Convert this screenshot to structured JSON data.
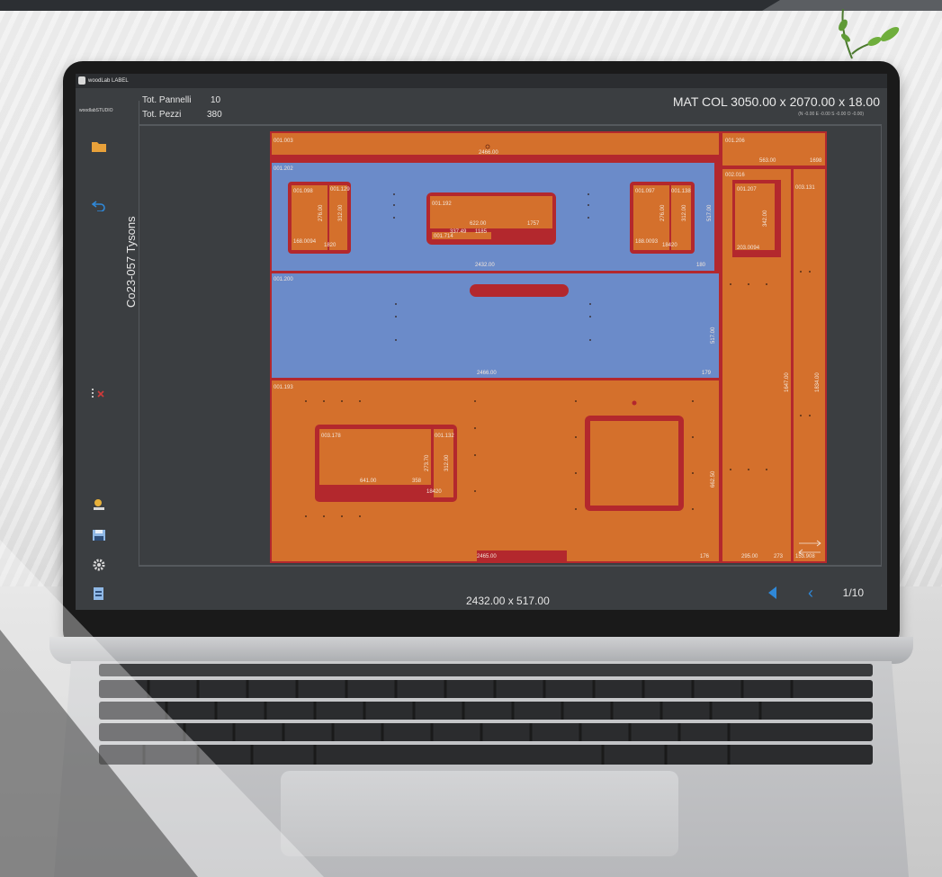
{
  "app": {
    "window_title": "woodLab LABEL",
    "brand": "woodlabSTUDIO",
    "project": "Co23-057 Tysons"
  },
  "stats": {
    "panels_label": "Tot. Pannelli",
    "panels_value": "10",
    "pieces_label": "Tot. Pezzi",
    "pieces_value": "380"
  },
  "material": {
    "title": "MAT COL 3050.00 x 2070.00 x 18.00",
    "offsets": "(N -0.00  E -0.00  S -0.00  O -0.00)"
  },
  "footer": {
    "selected_size": "2432.00 x 517.00",
    "page": "1/10"
  },
  "sidebar": {
    "icons": [
      "folder-icon",
      "undo-icon",
      "delete-icon",
      "user-settings-icon",
      "save-icon",
      "settings-gear-icon",
      "export-file-icon"
    ]
  },
  "colors": {
    "panel_orange": "#d4702c",
    "panel_blue": "#6b8bc9",
    "edge_red": "#b3282d",
    "nav_blue": "#2f88d8",
    "folder_amber": "#e8a13a"
  },
  "labels": {
    "p1": "001.003",
    "p1_dim": "2466.00",
    "p2": "001.206",
    "p2_dim": "563.00",
    "p2_h": "1698",
    "p3": "001.202",
    "p3_dim": "2432.00",
    "p3_h": "517.00",
    "p3_e": "180",
    "p3a": "001.098",
    "p3b": "001.129",
    "p3a_w": "168.0094",
    "p3a_b": "1820",
    "p3a_h": "276.00",
    "p3a_h2": "312.00",
    "p3c": "001.192",
    "p3c_w": "622.00",
    "p3c_b": "001.714",
    "p3c_b2": "337.49",
    "p3c_b3": "1185",
    "p3c_h": "1757",
    "p3d": "001.097",
    "p3e": "001.138",
    "p3d_w": "188.0093",
    "p3d_b": "18420",
    "p3d_h": "276.00",
    "p3d_h2": "312.00",
    "p4": "001.200",
    "p4_dim": "2466.00",
    "p4_h": "517.00",
    "p4_e": "179",
    "p5": "001.193",
    "p5_dim": "2465.00",
    "p5_e": "176",
    "p5a": "003.178",
    "p5b": "001.132",
    "p5a_w": "641.00",
    "p5a_s": "358",
    "p5a_b": "18420",
    "p5a_h": "273.70",
    "p5a_h2": "312.00",
    "p5_h": "662.50",
    "p6": "002.016",
    "p6a": "001.207",
    "p6a_w": "203.0094",
    "p6a_h": "342.00",
    "p6_h": "1647.00",
    "p6_b1": "295.00",
    "p6_b2": "273",
    "p7": "003.131",
    "p7_h": "1834.00",
    "p7_b": "153.908"
  }
}
